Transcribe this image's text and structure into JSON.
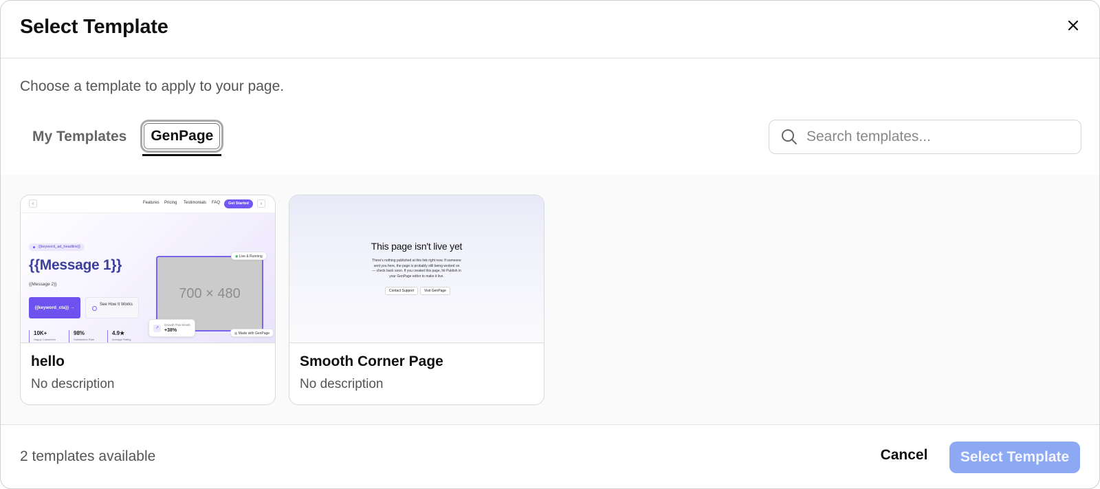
{
  "dialog": {
    "title": "Select Template",
    "subtitle": "Choose a template to apply to your page."
  },
  "tabs": [
    {
      "label": "My Templates",
      "active": false
    },
    {
      "label": "GenPage",
      "active": true
    }
  ],
  "search": {
    "placeholder": "Search templates...",
    "value": ""
  },
  "templates": [
    {
      "name": "hello",
      "description": "No description",
      "thumbnail": {
        "nav_links": [
          "Features",
          "Pricing",
          "Testimonials",
          "FAQ"
        ],
        "nav_cta": "Get Started",
        "badge": "{{keyword_ad_headline}}",
        "headline": "{{Message 1}}",
        "subheadline": "{{Message 2}}",
        "primary_cta": "{{keyword_cta}} →",
        "secondary_cta": "See How It Works",
        "image_placeholder": "700 × 480",
        "live_pill": "Live & Running",
        "made_with_pill": "Made with GenPage",
        "growth_label": "Growth This Month",
        "growth_value": "+38%",
        "stats": [
          {
            "value": "10K+",
            "label": "Happy Customers"
          },
          {
            "value": "98%",
            "label": "Satisfaction Rate"
          },
          {
            "value": "4.9★",
            "label": "Average Rating"
          }
        ]
      }
    },
    {
      "name": "Smooth Corner Page",
      "description": "No description",
      "thumbnail": {
        "title": "This page isn't live yet",
        "body": "There's nothing published at this link right now. If someone sent you here, the page is probably still being worked on — check back soon. If you created this page, hit Publish in your GenPage editor to make it live.",
        "buttons": [
          "Contact Support",
          "Visit GenPage"
        ]
      }
    }
  ],
  "footer": {
    "count_text": "2 templates available",
    "cancel_label": "Cancel",
    "select_label": "Select Template"
  },
  "colors": {
    "accent": "#7357f5",
    "primary_button_disabled": "#8ea9f3"
  }
}
